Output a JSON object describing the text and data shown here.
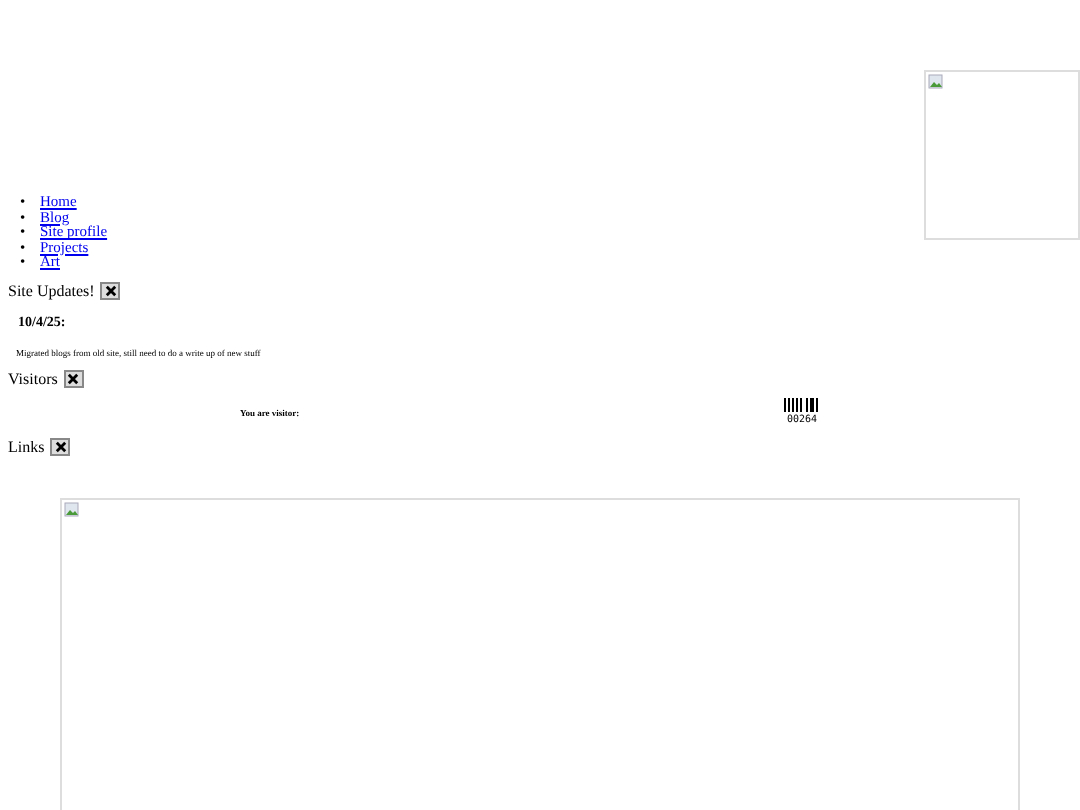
{
  "nav": [
    {
      "marker": "•",
      "label": "Home"
    },
    {
      "marker": "•",
      "label": "Blog"
    },
    {
      "marker": "•",
      "label": "Site profile"
    },
    {
      "marker": "•",
      "label": "Projects"
    },
    {
      "marker": "•",
      "label": "Art"
    }
  ],
  "site_updates": {
    "title": "Site Updates!",
    "date": "10/4/25:",
    "text": "Migrated blogs from old site, still need to do a write up of new stuff"
  },
  "visitors": {
    "title": "Visitors",
    "label": "You are visitor:",
    "count": "00264"
  },
  "links": {
    "title": "Links"
  }
}
